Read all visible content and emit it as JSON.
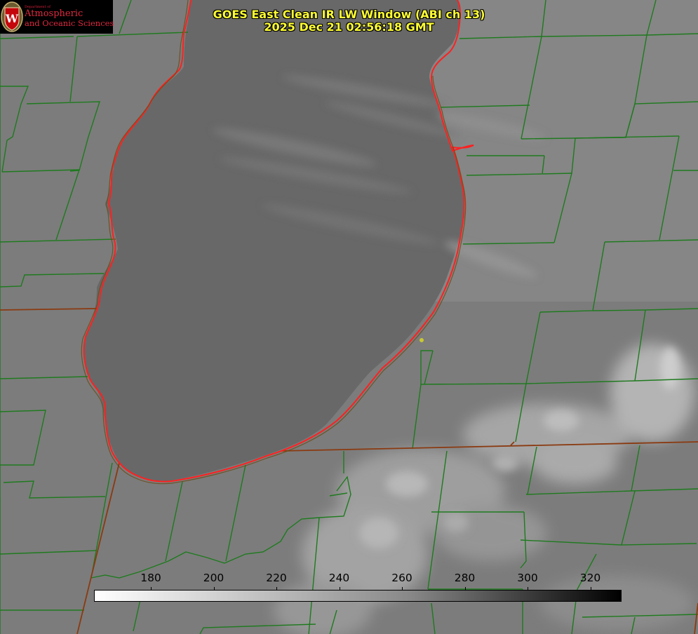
{
  "header": {
    "title_line1": "GOES East Clean IR LW Window (ABI ch 13)",
    "title_line2": "2025 Dec 21 02:56:18 GMT"
  },
  "logo": {
    "small_text": "Department of",
    "line1": "Atmospheric",
    "line2": "and Oceanic Sciences",
    "emblem_letter": "W"
  },
  "colorbar": {
    "ticks": [
      "180",
      "200",
      "220",
      "240",
      "260",
      "280",
      "300",
      "320"
    ],
    "gradient_start": "#ffffff",
    "gradient_end": "#000000",
    "units_note": ""
  },
  "map_colors": {
    "land": "#7d7d7d",
    "lake": "#676767",
    "county_lines": "#1e7a1e",
    "state_lines": "#8a3a10",
    "shoreline": "#ff2020",
    "marker": "#c8c832"
  }
}
